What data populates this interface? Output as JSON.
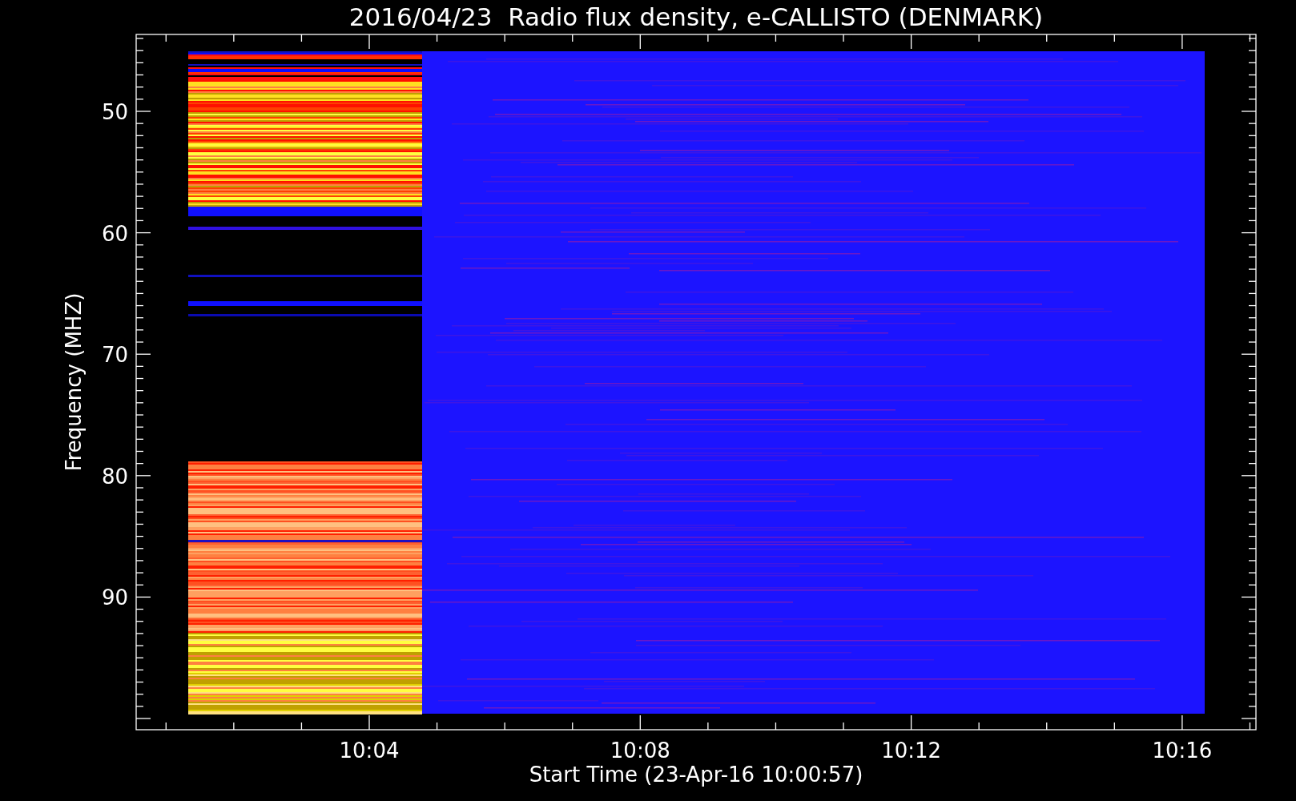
{
  "plot": {
    "title": "2016/04/23  Radio flux density, e-CALLISTO (DENMARK)",
    "ylabel": "Frequency (MHZ)",
    "xlabel": "Start Time (23-Apr-16 10:00:57)",
    "yticks": [
      "50",
      "60",
      "70",
      "80",
      "90"
    ],
    "xticks": [
      "10:04",
      "10:08",
      "10:12",
      "10:16"
    ]
  }
}
